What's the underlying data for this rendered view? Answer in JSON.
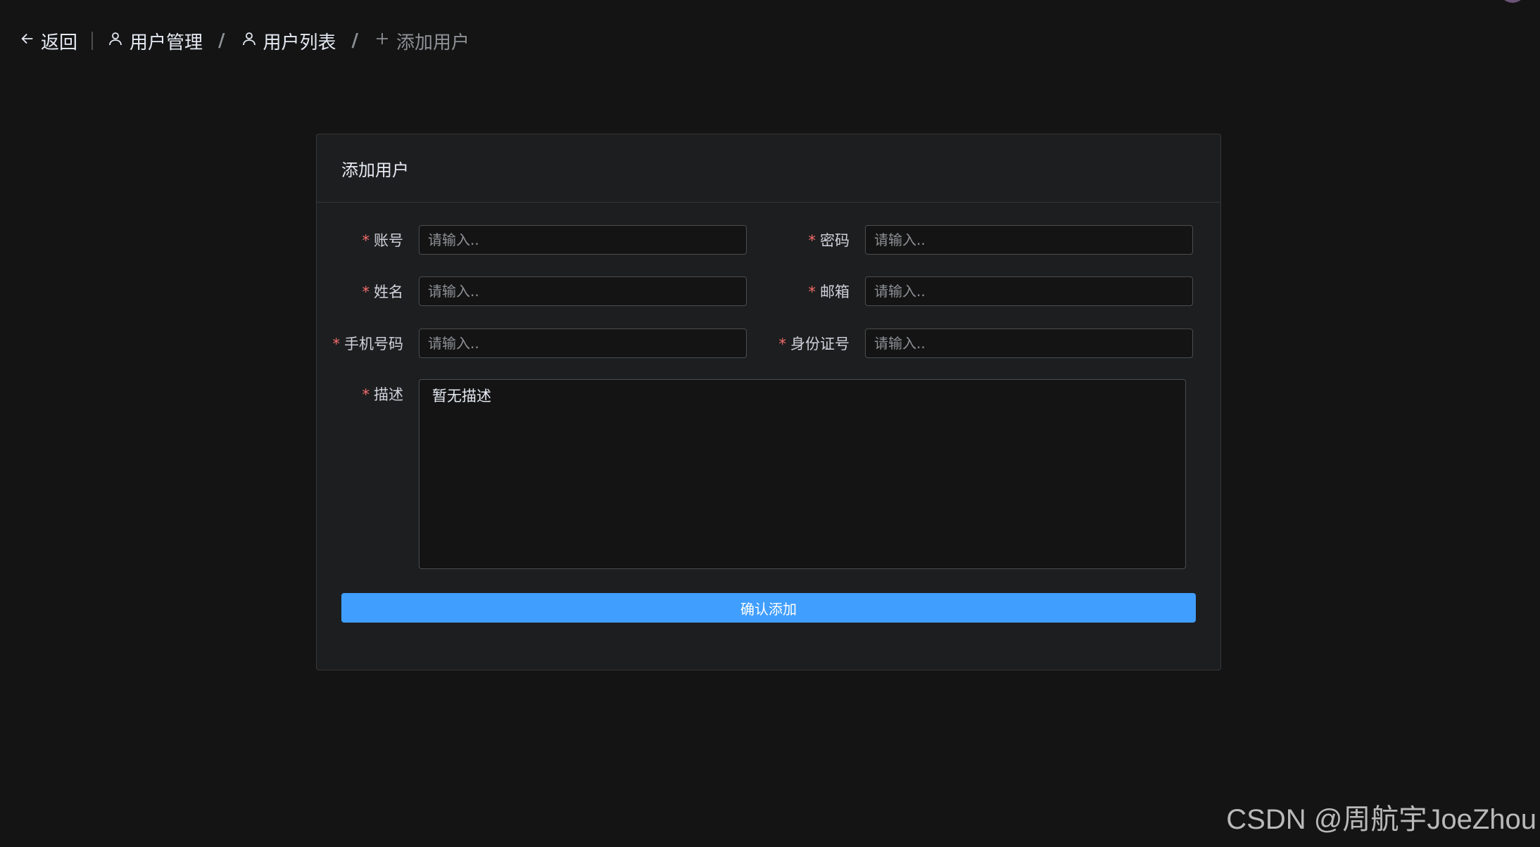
{
  "breadcrumb": {
    "back_label": "返回",
    "items": [
      {
        "label": "用户管理",
        "icon": "user-icon"
      },
      {
        "label": "用户列表",
        "icon": "user-icon"
      },
      {
        "label": "添加用户",
        "icon": "plus-icon"
      }
    ],
    "separator": "/"
  },
  "card": {
    "title": "添加用户"
  },
  "form": {
    "account": {
      "label": "账号",
      "placeholder": "请输入..",
      "value": ""
    },
    "password": {
      "label": "密码",
      "placeholder": "请输入..",
      "value": ""
    },
    "name": {
      "label": "姓名",
      "placeholder": "请输入..",
      "value": ""
    },
    "email": {
      "label": "邮箱",
      "placeholder": "请输入..",
      "value": ""
    },
    "phone": {
      "label": "手机号码",
      "placeholder": "请输入..",
      "value": ""
    },
    "id_number": {
      "label": "身份证号",
      "placeholder": "请输入..",
      "value": ""
    },
    "description": {
      "label": "描述",
      "value": "暂无描述"
    },
    "required_mark": "*",
    "submit_label": "确认添加"
  },
  "watermark": "CSDN @周航宇JoeZhou",
  "colors": {
    "background": "#141414",
    "card": "#1d1e1f",
    "primary": "#409eff",
    "required": "#f56c6c"
  }
}
